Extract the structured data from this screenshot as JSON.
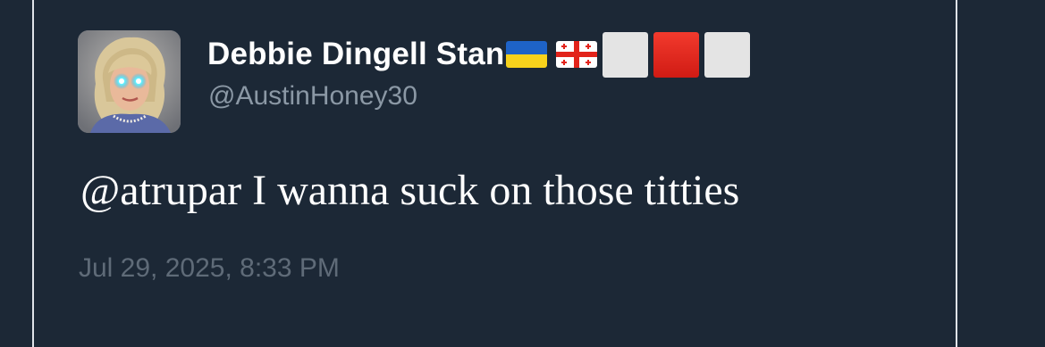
{
  "tweet": {
    "display_name": "Debbie Dingell Stan",
    "name_emojis": [
      "ukraine-flag",
      "georgia-flag",
      "white-square",
      "red-square",
      "white-square"
    ],
    "handle": "@AustinHoney30",
    "text": "@atrupar I wanna suck on those titties",
    "timestamp": "Jul 29, 2025, 8:33 PM"
  },
  "colors": {
    "background": "#1c2836",
    "frame_line": "#dfe3e8",
    "name_text": "#ffffff",
    "handle_text": "#8b98a5",
    "timestamp_text": "#5f6b78",
    "red_square": "#e8231d",
    "white_square": "#e4e4e4"
  }
}
